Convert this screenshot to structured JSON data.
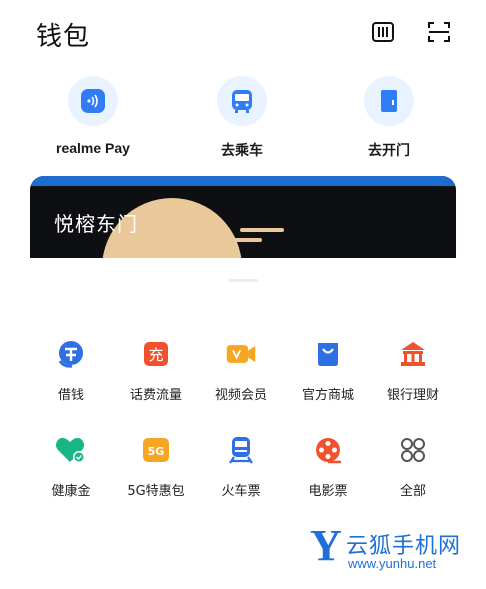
{
  "header": {
    "title": "钱包",
    "icons": [
      "barcode-icon",
      "scan-icon"
    ]
  },
  "shortcuts": [
    {
      "label": "realme Pay",
      "icon": "nfc-pay-icon"
    },
    {
      "label": "去乘车",
      "icon": "bus-icon"
    },
    {
      "label": "去开门",
      "icon": "door-icon"
    }
  ],
  "card": {
    "name": "悦榕东门"
  },
  "services": [
    {
      "label": "借钱",
      "icon": "loan-icon",
      "color": "#2f6fe4"
    },
    {
      "label": "话费流量",
      "icon": "recharge-icon",
      "color": "#f1522e"
    },
    {
      "label": "视频会员",
      "icon": "video-vip-icon",
      "color": "#f6a623"
    },
    {
      "label": "官方商城",
      "icon": "shopping-bag-icon",
      "color": "#2f6fe4"
    },
    {
      "label": "银行理财",
      "icon": "bank-icon",
      "color": "#f1522e"
    },
    {
      "label": "健康金",
      "icon": "health-heart-icon",
      "color": "#19b584"
    },
    {
      "label": "5G特惠包",
      "icon": "5g-icon",
      "color": "#f6a623"
    },
    {
      "label": "火车票",
      "icon": "train-icon",
      "color": "#2f6fe4"
    },
    {
      "label": "电影票",
      "icon": "film-reel-icon",
      "color": "#f1522e"
    },
    {
      "label": "全部",
      "icon": "all-grid-icon",
      "color": "#555555"
    }
  ],
  "watermark": {
    "letter": "Y",
    "name": "云狐手机网",
    "url": "www.yunhu.net"
  }
}
